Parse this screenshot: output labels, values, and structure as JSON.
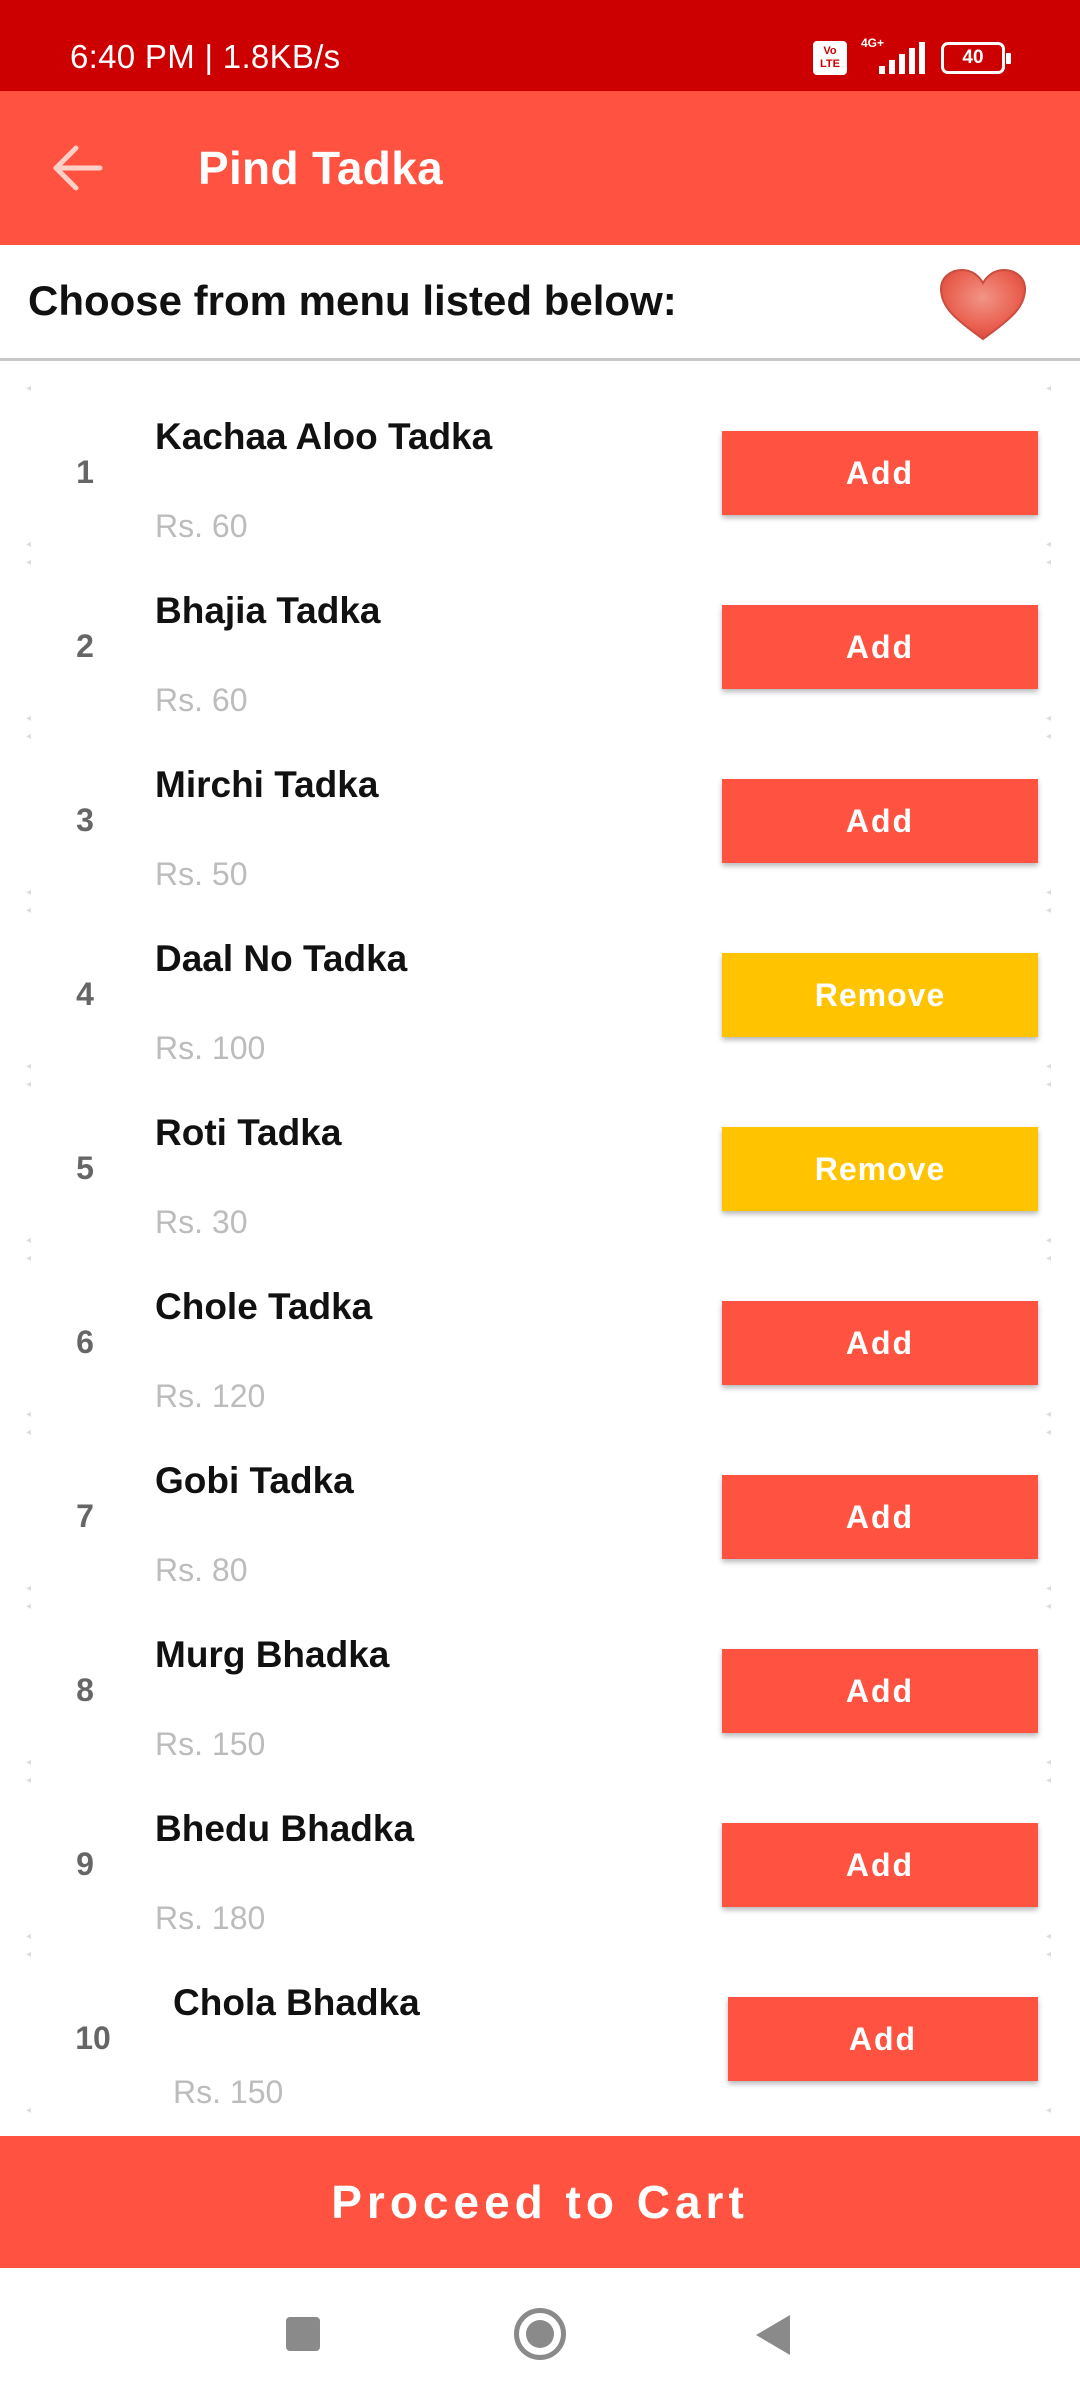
{
  "status_bar": {
    "time": "6:40 PM | 1.8KB/s",
    "volte": "Vo LTE",
    "network": "4G+",
    "battery": "40"
  },
  "app_bar": {
    "title": "Pind Tadka",
    "back_icon": "arrow-left-icon"
  },
  "subheader": {
    "heading": "Choose from menu listed below:",
    "favorite_icon": "heart-icon"
  },
  "menu_items": [
    {
      "num": "1",
      "name": "Kachaa Aloo Tadka",
      "price": "Rs. 60",
      "action": "Add"
    },
    {
      "num": "2",
      "name": "Bhajia Tadka",
      "price": "Rs. 60",
      "action": "Add"
    },
    {
      "num": "3",
      "name": "Mirchi Tadka",
      "price": "Rs. 50",
      "action": "Add"
    },
    {
      "num": "4",
      "name": "Daal No Tadka",
      "price": "Rs. 100",
      "action": "Remove"
    },
    {
      "num": "5",
      "name": "Roti Tadka",
      "price": "Rs. 30",
      "action": "Remove"
    },
    {
      "num": "6",
      "name": "Chole Tadka",
      "price": "Rs. 120",
      "action": "Add"
    },
    {
      "num": "7",
      "name": "Gobi Tadka",
      "price": "Rs. 80",
      "action": "Add"
    },
    {
      "num": "8",
      "name": "Murg Bhadka",
      "price": "Rs. 150",
      "action": "Add"
    },
    {
      "num": "9",
      "name": "Bhedu Bhadka",
      "price": "Rs. 180",
      "action": "Add"
    },
    {
      "num": "10",
      "name": "Chola Bhadka",
      "price": "Rs. 150",
      "action": "Add"
    }
  ],
  "footer": {
    "proceed_label": "Proceed to Cart"
  },
  "nav_bar": {
    "recent_icon": "square-icon",
    "home_icon": "circle-home-icon",
    "back_icon": "triangle-back-icon"
  },
  "colors": {
    "status_bar": "#cc0000",
    "primary": "#ff5240",
    "remove": "#ffc300",
    "price_text": "#bcbcbc"
  }
}
